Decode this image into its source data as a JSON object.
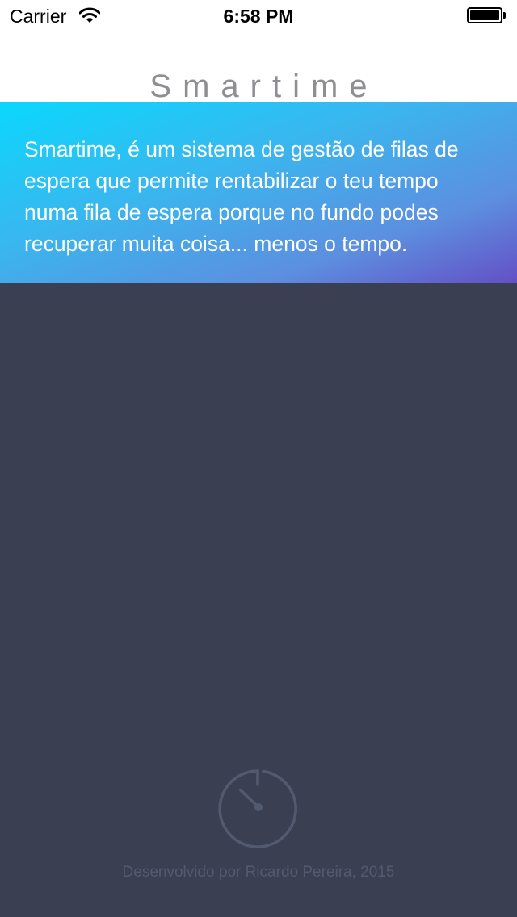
{
  "status_bar": {
    "carrier": "Carrier",
    "time": "6:58 PM",
    "wifi_icon": "wifi-icon",
    "battery_icon": "battery-icon",
    "battery_level": 1.0
  },
  "nav": {
    "title": "Smartime"
  },
  "banner": {
    "text": "Smartime, é um sistema de gestão de filas de espera que permite rentabilizar o teu tempo numa fila de espera porque no fundo podes recuperar muita coisa... menos o tempo.",
    "gradient": [
      "#0ad8fd",
      "#6450c6"
    ]
  },
  "footer": {
    "logo_icon": "stopwatch-icon",
    "credit": "Desenvolvido por Ricardo Pereira, 2015"
  },
  "colors": {
    "background": "#3a4052",
    "footer_muted": "#525a70"
  }
}
